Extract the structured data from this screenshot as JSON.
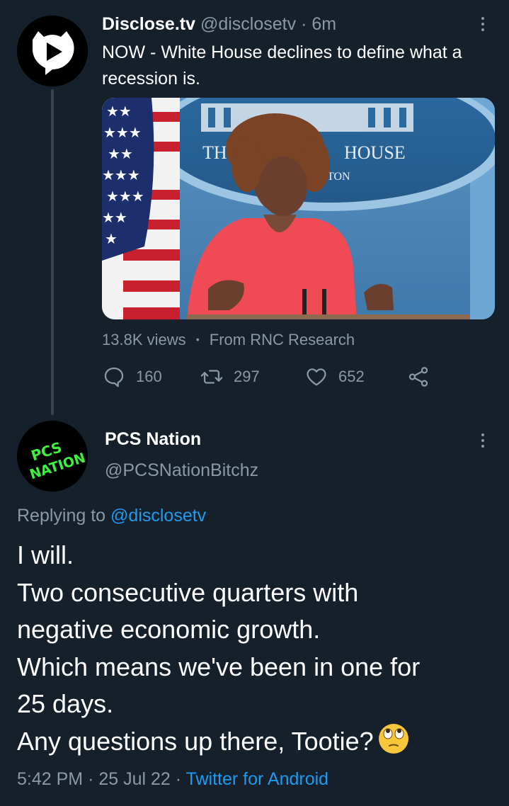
{
  "tweet1": {
    "display_name": "Disclose.tv",
    "handle": "@disclosetv",
    "separator": "·",
    "time": "6m",
    "text": "NOW - White House declines to define what a recession is.",
    "media": {
      "backdrop_text_left": "TH",
      "backdrop_text_right": "HOUSE",
      "backdrop_text_sub": "TON"
    },
    "views": "13.8K views",
    "source_separator": "•",
    "source": "From RNC Research",
    "stats": {
      "replies": "160",
      "retweets": "297",
      "likes": "652"
    }
  },
  "tweet2": {
    "avatar_text_line1": "PCS",
    "avatar_text_line2": "NATION",
    "display_name": "PCS Nation",
    "handle": "@PCSNationBitchz",
    "replying_prefix": "Replying to",
    "replying_to": "@disclosetv",
    "lines": [
      "I will.",
      "Two consecutive quarters with",
      "negative economic growth.",
      "Which means we've been in one for",
      "25 days.",
      "Any questions up there, Tootie?"
    ],
    "time": "5:42 PM",
    "separator": "·",
    "date": "25 Jul 22",
    "separator2": "·",
    "client": "Twitter for Android"
  },
  "colors": {
    "background": "#15202b",
    "secondary_text": "#8b98a5",
    "link": "#1d9bf0",
    "thread_line": "#38444d"
  }
}
